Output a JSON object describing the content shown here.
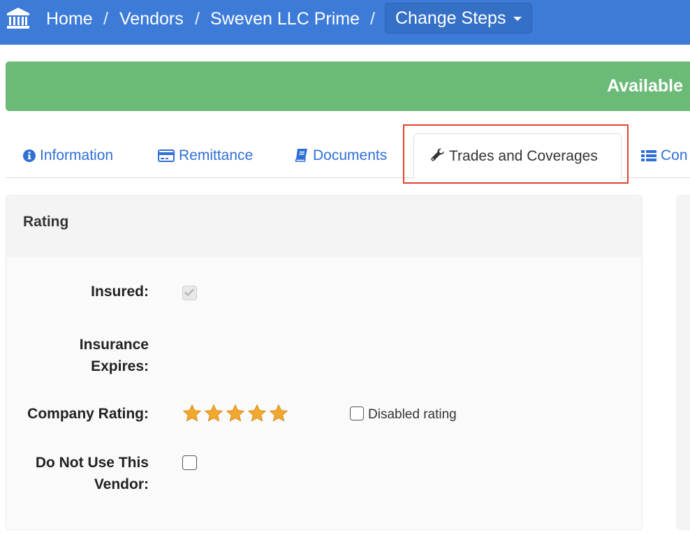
{
  "breadcrumb": {
    "items": [
      "Home",
      "Vendors",
      "Sweven LLC Prime"
    ],
    "separator": "/",
    "dropdown_label": "Change Steps"
  },
  "status": {
    "label": "Available",
    "color": "#6cba77"
  },
  "tabs": [
    {
      "label": "Information",
      "icon": "info-circle-icon"
    },
    {
      "label": "Remittance",
      "icon": "credit-card-icon"
    },
    {
      "label": "Documents",
      "icon": "book-icon"
    },
    {
      "label": "Trades and Coverages",
      "icon": "wrench-icon",
      "active": true
    },
    {
      "label": "Con",
      "icon": "list-icon"
    }
  ],
  "panel": {
    "title": "Rating",
    "fields": {
      "insured_label": "Insured:",
      "insured_checked": true,
      "insurance_expires_label_line1": "Insurance",
      "insurance_expires_label_line2": "Expires:",
      "company_rating_label": "Company Rating:",
      "rating_stars": 5,
      "rating_max": 5,
      "disabled_rating_label": "Disabled rating",
      "do_not_use_label_line1": "Do Not Use This",
      "do_not_use_label_line2": "Vendor:"
    }
  },
  "colors": {
    "nav": "#3d7bd9",
    "link": "#2f6fd6",
    "star": "#f0a82e",
    "highlight": "#e2412f"
  }
}
